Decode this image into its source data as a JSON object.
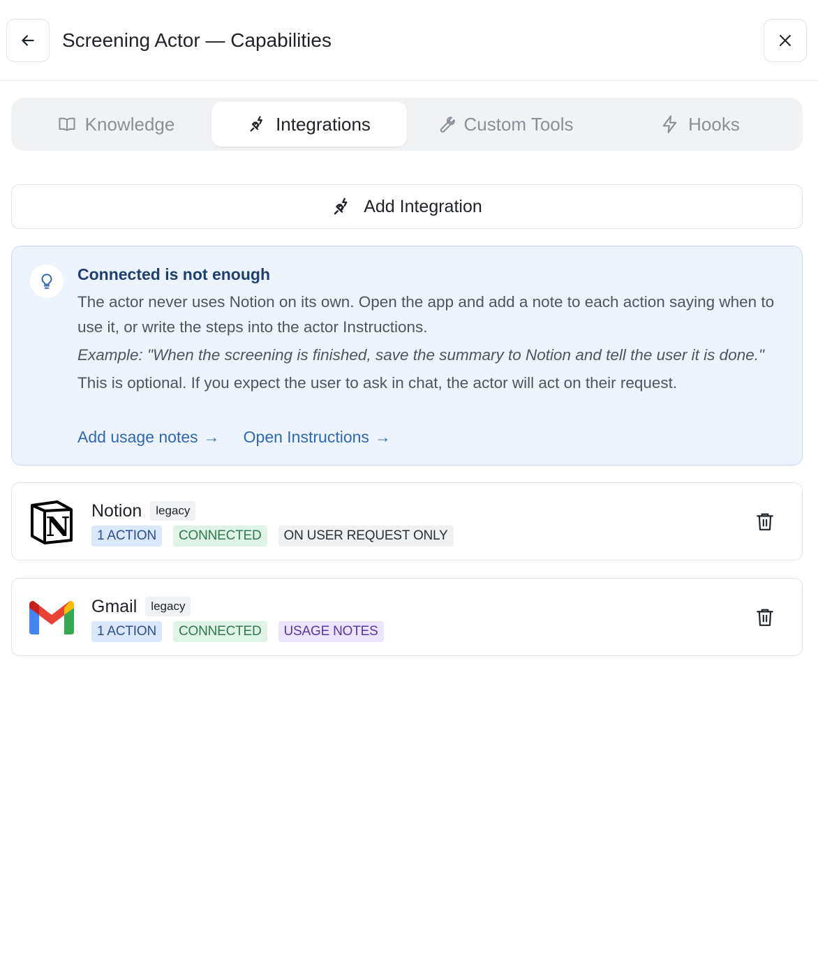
{
  "header": {
    "title": "Screening Actor — Capabilities",
    "back_icon": "arrow-left-icon",
    "close_icon": "close-icon"
  },
  "tabs": [
    {
      "label": "Knowledge",
      "icon": "book-icon",
      "active": false
    },
    {
      "label": "Integrations",
      "icon": "plug-icon",
      "active": true
    },
    {
      "label": "Custom Tools",
      "icon": "wrench-icon",
      "active": false
    },
    {
      "label": "Hooks",
      "icon": "lightning-icon",
      "active": false
    }
  ],
  "add_integration": {
    "label": "Add Integration",
    "icon": "plug-icon"
  },
  "tip": {
    "icon": "lightbulb-icon",
    "title": "Connected is not enough",
    "body": "The actor never uses Notion on its own. Open the app and add a note to each action saying when to use it, or write the steps into the actor Instructions.",
    "example": "Example: \"When the screening is finished, save the summary to Notion and tell the user it is done.\"",
    "optional": "This is optional. If you expect the user to ask in chat, the actor will act on their request.",
    "links": [
      {
        "label": "Add usage notes",
        "arrow": "→"
      },
      {
        "label": "Open Instructions",
        "arrow": "→"
      }
    ]
  },
  "integrations": [
    {
      "name": "Notion",
      "tag": "legacy",
      "logo": "notion-logo-icon",
      "badges": [
        "1 ACTION",
        "CONNECTED",
        "ON USER REQUEST ONLY"
      ]
    },
    {
      "name": "Gmail",
      "tag": "legacy",
      "logo": "gmail-logo-icon",
      "badges": [
        "1 ACTION",
        "CONNECTED",
        "USAGE NOTES"
      ]
    }
  ],
  "colors": {
    "tip_background": "#eef4fd",
    "tip_title": "#1d3f72",
    "link": "#2f67b2",
    "badge_action": "#dbe7fb",
    "badge_connected": "#dff3e7",
    "badge_notes": "#ece4fb"
  }
}
